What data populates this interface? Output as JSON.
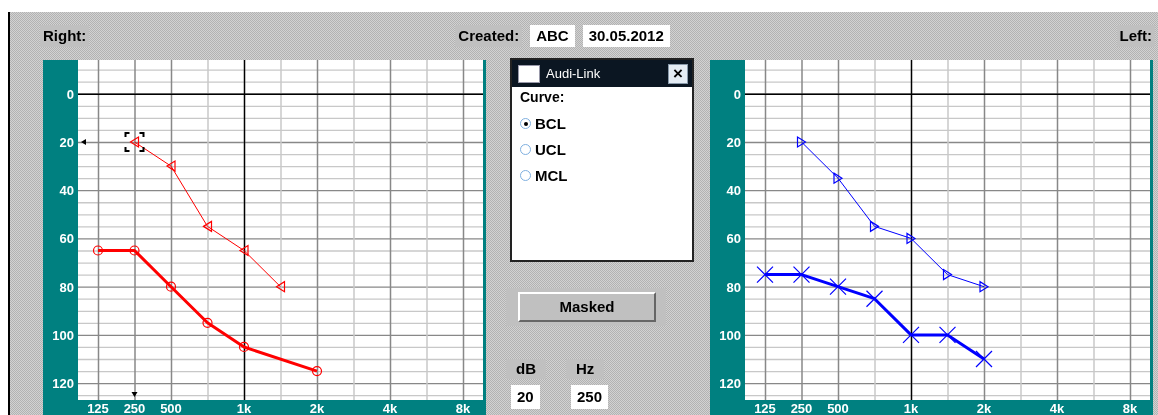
{
  "header": {
    "right_label": "Right:",
    "created_label": "Created:",
    "created_by": "ABC",
    "created_date": "30.05.2012",
    "left_label": "Left:"
  },
  "right_audiogram": {
    "chart_data": {
      "type": "line",
      "categories": [
        "125",
        "250",
        "500",
        null,
        "1k",
        null,
        "2k",
        null,
        "4k",
        null,
        "8k"
      ],
      "ylim": [
        127,
        -14
      ],
      "grid": true,
      "yticks": [
        0,
        20,
        40,
        60,
        80,
        100,
        120
      ],
      "series": [
        {
          "marker": "circle",
          "color": "#ff0000",
          "values": [
            65,
            65,
            80,
            95,
            105,
            null,
            115,
            null,
            null,
            null,
            null
          ]
        },
        {
          "marker": "triangle",
          "color": "#ff0000",
          "values": [
            null,
            20,
            30,
            55,
            65,
            80,
            null,
            null,
            null,
            null,
            null
          ]
        }
      ]
    }
  },
  "dialog": {
    "title": "Audi-Link",
    "close": "×",
    "group_label": "Curve:",
    "options": [
      {
        "label": "BCL",
        "selected": true
      },
      {
        "label": "UCL",
        "selected": false
      },
      {
        "label": "MCL",
        "selected": false
      }
    ]
  },
  "masked_button": "Masked",
  "readout": {
    "db_label": "dB",
    "hz_label": "Hz",
    "db": "20",
    "hz": "250"
  },
  "left_audiogram": {
    "chart_data": {
      "type": "line",
      "categories": [
        "125",
        "250",
        "500",
        null,
        "1k",
        null,
        "2k",
        null,
        "4k",
        null,
        "8k"
      ],
      "ylim": [
        127,
        -14
      ],
      "grid": true,
      "yticks": [
        0,
        20,
        40,
        60,
        80,
        100,
        120
      ],
      "series": [
        {
          "marker": "cross",
          "color": "#0000ff",
          "values": [
            75,
            75,
            80,
            85,
            100,
            100,
            110,
            null,
            null,
            null,
            null
          ]
        },
        {
          "marker": "triangle",
          "color": "#0000ff",
          "values": [
            null,
            20,
            35,
            55,
            60,
            75,
            80,
            null,
            null,
            null,
            null
          ]
        }
      ]
    }
  }
}
